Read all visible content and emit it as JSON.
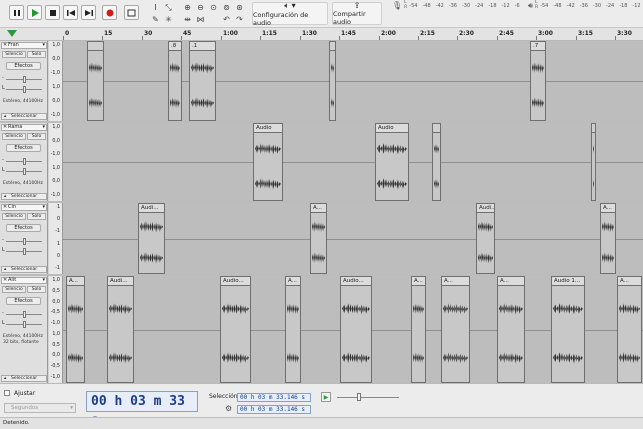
{
  "toolbar": {
    "audio_setup_label": "Configuración de audio",
    "share_audio_label": "Compartir audio",
    "rec_meter_ticks": [
      "-54",
      "-48",
      "-42",
      "-36",
      "-30",
      "-24",
      "-18",
      "-12",
      "-6"
    ],
    "play_meter_ticks": [
      "-54",
      "-48",
      "-42",
      "-36",
      "-30",
      "-24",
      "-18",
      "-12",
      "-6"
    ],
    "meter_channels": [
      "L",
      "R"
    ]
  },
  "timeline": {
    "ticks": [
      "0",
      "15",
      "30",
      "45",
      "1:00",
      "1:15",
      "1:30",
      "1:45",
      "2:00",
      "2:15",
      "2:30",
      "2:45",
      "3:00",
      "3:15",
      "3:30"
    ]
  },
  "tracks": [
    {
      "name": "Fran",
      "silence": "Silencio",
      "solo": "Solo",
      "effects": "Efectos",
      "info": [
        "Estéreo, 44100Hz"
      ],
      "select": "Seleccionar",
      "scale": [
        "1,0",
        "0,0",
        "-1,0",
        "1,0",
        "0,0",
        "-1,0"
      ],
      "clips": [
        {
          "label": ""
        },
        {
          "label": ".8"
        },
        {
          "label": ".1"
        },
        {
          "label": ""
        },
        {
          "label": ".7"
        }
      ]
    },
    {
      "name": "Rama",
      "silence": "Silencio",
      "solo": "Solo",
      "effects": "Efectos",
      "info": [
        "Estéreo, 44100Hz"
      ],
      "select": "Seleccionar",
      "scale": [
        "1,0",
        "0,0",
        "-1,0",
        "1,0",
        "0,0",
        "-1,0"
      ],
      "clips": [
        {
          "label": "Audio"
        },
        {
          "label": "Audio"
        },
        {
          "label": ""
        },
        {
          "label": ""
        }
      ]
    },
    {
      "name": "Cin",
      "silence": "Silencio",
      "solo": "Solo",
      "effects": "Efectos",
      "info": [],
      "select": "Seleccionar",
      "scale": [
        "1",
        "0",
        "-1",
        "1",
        "0",
        "-1"
      ],
      "clips": [
        {
          "label": "Audi..."
        },
        {
          "label": "A..."
        },
        {
          "label": "Audi..."
        },
        {
          "label": "A..."
        }
      ]
    },
    {
      "name": "Alit",
      "silence": "Silencio",
      "solo": "Solo",
      "effects": "Efectos",
      "info": [
        "Estéreo, 44100Hz",
        "32 bits, flotante"
      ],
      "select": "Seleccionar",
      "scale": [
        "1,0",
        "0,5",
        "0,0",
        "-0,5",
        "-1,0",
        "1,0",
        "0,5",
        "0,0",
        "-0,5",
        "-1,0"
      ],
      "clips": [
        {
          "label": "A..."
        },
        {
          "label": "Audi..."
        },
        {
          "label": "Audio..."
        },
        {
          "label": "A..."
        },
        {
          "label": "Audio..."
        },
        {
          "label": "A..."
        },
        {
          "label": "A..."
        },
        {
          "label": "A..."
        },
        {
          "label": "Audio 1..."
        },
        {
          "label": "A..."
        }
      ]
    }
  ],
  "bottom": {
    "snap_label": "Ajustar",
    "snap_mode": "Segundos",
    "time": "00 h 03 m 33 s",
    "selection_label": "Selección",
    "sel_start": "00 h 03 m 33.146 s",
    "sel_end": "00 h 03 m 33.146 s"
  },
  "status": "Detenido."
}
